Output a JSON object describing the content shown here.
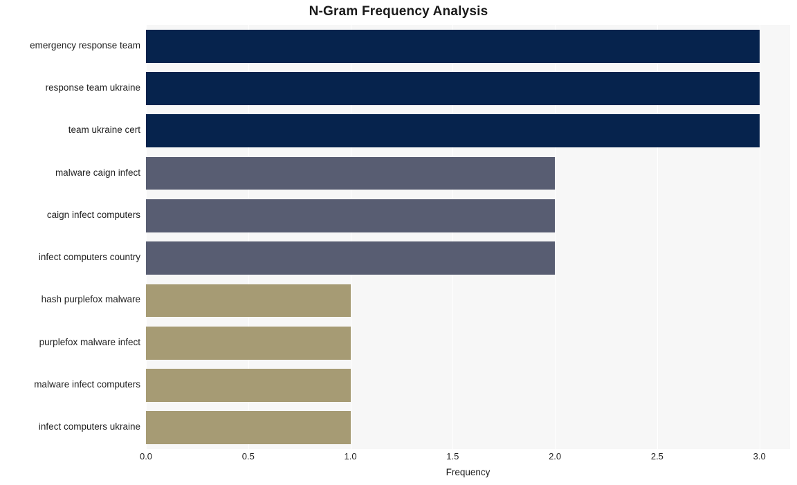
{
  "chart_data": {
    "type": "bar",
    "orientation": "horizontal",
    "title": "N-Gram Frequency Analysis",
    "xlabel": "Frequency",
    "ylabel": "",
    "xlim": [
      0.0,
      3.15
    ],
    "grid": true,
    "legend": "none",
    "categories": [
      "emergency response team",
      "response team ukraine",
      "team ukraine cert",
      "malware caign infect",
      "caign infect computers",
      "infect computers country",
      "hash purplefox malware",
      "purplefox malware infect",
      "malware infect computers",
      "infect computers ukraine"
    ],
    "values": [
      3,
      3,
      3,
      2,
      2,
      2,
      1,
      1,
      1,
      1
    ],
    "bar_colors": [
      "#06234d",
      "#06234d",
      "#06234d",
      "#585d72",
      "#585d72",
      "#585d72",
      "#a69b74",
      "#a69b74",
      "#a69b74",
      "#a69b74"
    ],
    "xticks": [
      "0.0",
      "0.5",
      "1.0",
      "1.5",
      "2.0",
      "2.5",
      "3.0"
    ],
    "xtick_values": [
      0.0,
      0.5,
      1.0,
      1.5,
      2.0,
      2.5,
      3.0
    ],
    "plot_background": "#f7f7f7",
    "grid_color": "#ffffff"
  }
}
